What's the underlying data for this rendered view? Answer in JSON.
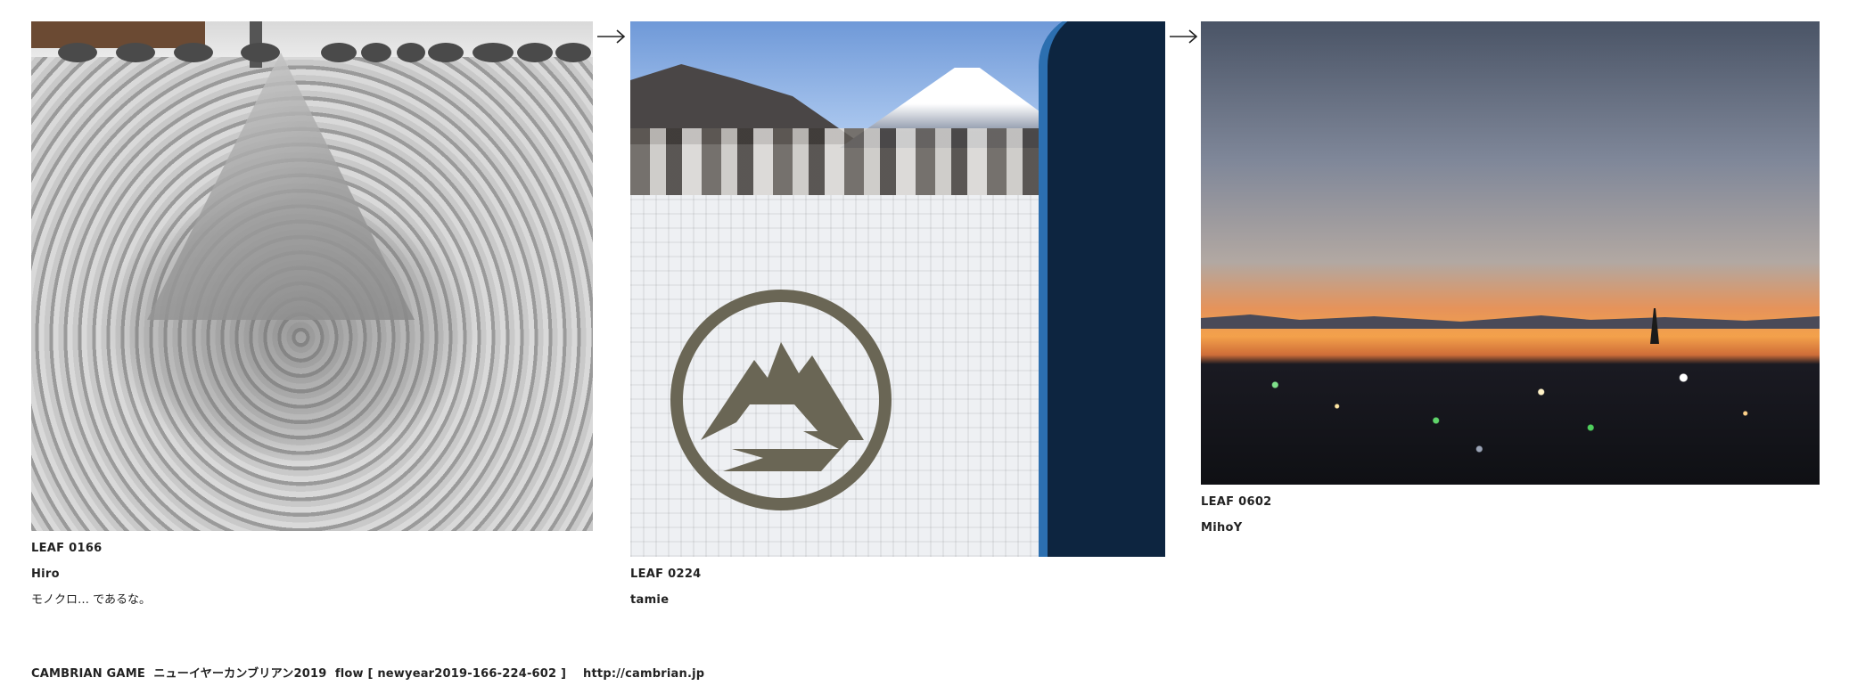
{
  "cards": [
    {
      "leaf": "LEAF 0166",
      "author": "Hiro",
      "comment": "モノクロ… であるな。"
    },
    {
      "leaf": "LEAF 0224",
      "author": "tamie"
    },
    {
      "leaf": "LEAF 0602",
      "author": "MihoY"
    }
  ],
  "footer": {
    "text": "CAMBRIAN GAME  ニューイヤーカンブリアン2019  flow [ newyear2019-166-224-602 ]    http://cambrian.jp"
  },
  "icons": [
    "arrow-right-icon",
    "mountain-emblem-icon"
  ],
  "colors": {
    "window_frame": "#0d2540",
    "frame_edge": "#2c6fb0",
    "sunset": "#f3a14b"
  }
}
